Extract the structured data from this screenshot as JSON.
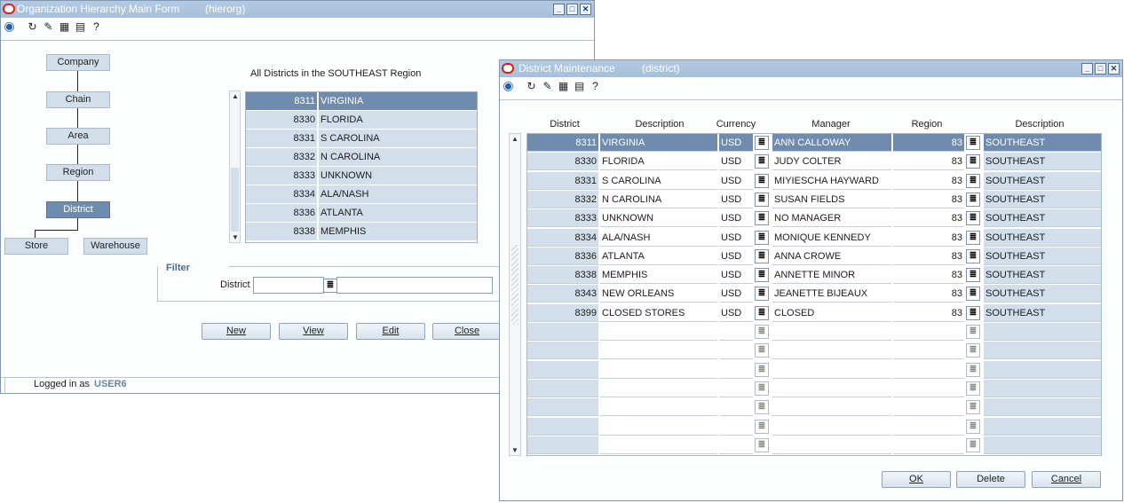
{
  "main_window": {
    "title": "Organization Hierarchy Main Form",
    "subtitle": "(hierorg)",
    "hierarchy": [
      "Company",
      "Chain",
      "Area",
      "Region",
      "District"
    ],
    "store_label": "Store",
    "warehouse_label": "Warehouse",
    "list_caption": "All Districts in the SOUTHEAST Region",
    "district_list": [
      {
        "code": "8311",
        "name": "VIRGINIA"
      },
      {
        "code": "8330",
        "name": "FLORIDA"
      },
      {
        "code": "8331",
        "name": "S CAROLINA"
      },
      {
        "code": "8332",
        "name": "N CAROLINA"
      },
      {
        "code": "8333",
        "name": "UNKNOWN"
      },
      {
        "code": "8334",
        "name": "ALA/NASH"
      },
      {
        "code": "8336",
        "name": "ATLANTA"
      },
      {
        "code": "8338",
        "name": "MEMPHIS"
      }
    ],
    "filter_label": "Filter",
    "district_label": "District",
    "district_value": "",
    "district_desc_value": "",
    "buttons": {
      "new": "New",
      "view": "View",
      "edit": "Edit",
      "close": "Close"
    },
    "logged_in_label": "Logged in as",
    "user": "USER6"
  },
  "district_window": {
    "title": "District Maintenance",
    "subtitle": "(district)",
    "columns": {
      "district": "District",
      "description": "Description",
      "currency": "Currency",
      "manager": "Manager",
      "region": "Region",
      "region_description": "Description"
    },
    "rows": [
      {
        "district": "8311",
        "description": "VIRGINIA",
        "currency": "USD",
        "manager": "ANN      CALLOWAY",
        "region": "83",
        "region_description": "SOUTHEAST"
      },
      {
        "district": "8330",
        "description": "FLORIDA",
        "currency": "USD",
        "manager": "JUDY      COLTER",
        "region": "83",
        "region_description": "SOUTHEAST"
      },
      {
        "district": "8331",
        "description": "S CAROLINA",
        "currency": "USD",
        "manager": "MIYIESCHA HAYWARD",
        "region": "83",
        "region_description": "SOUTHEAST"
      },
      {
        "district": "8332",
        "description": "N CAROLINA",
        "currency": "USD",
        "manager": "SUSAN      FIELDS",
        "region": "83",
        "region_description": "SOUTHEAST"
      },
      {
        "district": "8333",
        "description": "UNKNOWN",
        "currency": "USD",
        "manager": "NO MANAGER",
        "region": "83",
        "region_description": "SOUTHEAST"
      },
      {
        "district": "8334",
        "description": "ALA/NASH",
        "currency": "USD",
        "manager": "MONIQUE    KENNEDY",
        "region": "83",
        "region_description": "SOUTHEAST"
      },
      {
        "district": "8336",
        "description": "ATLANTA",
        "currency": "USD",
        "manager": "ANNA      CROWE",
        "region": "83",
        "region_description": "SOUTHEAST"
      },
      {
        "district": "8338",
        "description": "MEMPHIS",
        "currency": "USD",
        "manager": "ANNETTE    MINOR",
        "region": "83",
        "region_description": "SOUTHEAST"
      },
      {
        "district": "8343",
        "description": "NEW ORLEANS",
        "currency": "USD",
        "manager": "JEANETTE  BIJEAUX",
        "region": "83",
        "region_description": "SOUTHEAST"
      },
      {
        "district": "8399",
        "description": "CLOSED STORES",
        "currency": "USD",
        "manager": "CLOSED",
        "region": "83",
        "region_description": "SOUTHEAST"
      }
    ],
    "empty_rows": 7,
    "buttons": {
      "ok": "OK",
      "delete": "Delete",
      "cancel": "Cancel"
    }
  },
  "colors": {
    "title_bar": "#a7bfda",
    "row_fill": "#d2deea",
    "selected_row": "#6f8bad",
    "node_active": "#6f8bad"
  },
  "icons": [
    "oracle-logo-icon",
    "globe-icon",
    "help-icon",
    "list-of-values-icon"
  ]
}
